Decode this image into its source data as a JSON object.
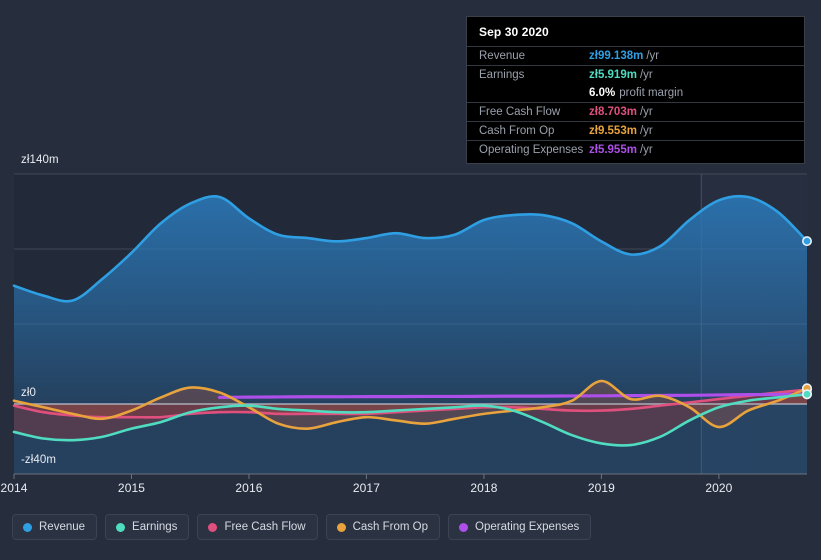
{
  "tooltip": {
    "title": "Sep 30 2020",
    "rows": [
      {
        "key": "Revenue",
        "value": "zł99.138m",
        "unit": "/yr",
        "color": "#2f9fe3"
      },
      {
        "key": "Earnings",
        "value": "zł5.919m",
        "unit": "/yr",
        "color": "#4fdcc0"
      },
      {
        "key": "",
        "value": "6.0%",
        "unit": "",
        "sub": "profit margin",
        "color": "#ffffff"
      },
      {
        "key": "Free Cash Flow",
        "value": "zł8.703m",
        "unit": "/yr",
        "color": "#e0507e"
      },
      {
        "key": "Cash From Op",
        "value": "zł9.553m",
        "unit": "/yr",
        "color": "#e8a33d"
      },
      {
        "key": "Operating Expenses",
        "value": "zł5.955m",
        "unit": "/yr",
        "color": "#ad4fe8"
      }
    ]
  },
  "legend": {
    "items": [
      {
        "label": "Revenue",
        "color": "#2f9fe3"
      },
      {
        "label": "Earnings",
        "color": "#4fdcc0"
      },
      {
        "label": "Free Cash Flow",
        "color": "#e0507e"
      },
      {
        "label": "Cash From Op",
        "color": "#e8a33d"
      },
      {
        "label": "Operating Expenses",
        "color": "#ad4fe8"
      }
    ]
  },
  "chart_data": {
    "type": "area",
    "title": "",
    "xlabel": "",
    "ylabel": "",
    "currency_symbol": "zł",
    "units": "m",
    "ylim": [
      -40,
      140
    ],
    "yticks": [
      140,
      0,
      -40
    ],
    "ytick_labels": [
      "zł140m",
      "zł0",
      "-zł40m"
    ],
    "grid": true,
    "legend_position": "bottom-left",
    "x": [
      2014.0,
      2014.25,
      2014.5,
      2014.75,
      2015.0,
      2015.25,
      2015.5,
      2015.75,
      2016.0,
      2016.25,
      2016.5,
      2016.75,
      2017.0,
      2017.25,
      2017.5,
      2017.75,
      2018.0,
      2018.25,
      2018.5,
      2018.75,
      2019.0,
      2019.25,
      2019.5,
      2019.75,
      2020.0,
      2020.25,
      2020.5,
      2020.75
    ],
    "xticks": [
      2014,
      2015,
      2016,
      2017,
      2018,
      2019,
      2020
    ],
    "xtick_labels": [
      "2014",
      "2015",
      "2016",
      "2017",
      "2018",
      "2019",
      "2020"
    ],
    "forecast_start": 2019.85,
    "series": [
      {
        "name": "Revenue",
        "color": "#2f9fe3",
        "filled": true,
        "values": [
          72,
          66,
          63,
          76,
          92,
          110,
          122,
          126,
          113,
          103,
          101,
          99,
          101,
          104,
          101,
          103,
          112,
          115,
          115,
          110,
          99,
          91,
          96,
          112,
          124,
          126,
          117,
          99.138
        ]
      },
      {
        "name": "Earnings",
        "color": "#4fdcc0",
        "filled": true,
        "values": [
          -17,
          -21,
          -22,
          -20,
          -15,
          -11,
          -5,
          -2,
          -1,
          -3,
          -4,
          -5,
          -5,
          -4,
          -3,
          -2,
          -1,
          -4,
          -11,
          -19,
          -24,
          -25,
          -20,
          -10,
          -2,
          2,
          4,
          5.919
        ]
      },
      {
        "name": "Free Cash Flow",
        "color": "#e0507e",
        "filled": true,
        "values": [
          -1,
          -5,
          -7,
          -8,
          -8,
          -8,
          -6,
          -5,
          -5,
          -6,
          -6,
          -6,
          -6,
          -5,
          -4,
          -3,
          -2,
          -2,
          -3,
          -4,
          -4,
          -3,
          -1,
          1,
          3,
          5,
          7,
          8.703
        ]
      },
      {
        "name": "Cash From Op",
        "color": "#e8a33d",
        "filled": false,
        "values": [
          2,
          -2,
          -6,
          -9,
          -4,
          4,
          10,
          7,
          -2,
          -12,
          -15,
          -11,
          -8,
          -10,
          -12,
          -9,
          -6,
          -4,
          -2,
          2,
          14,
          3,
          5,
          -2,
          -14,
          -4,
          2,
          9.553
        ]
      },
      {
        "name": "Operating Expenses",
        "color": "#ad4fe8",
        "filled": false,
        "start_index": 7,
        "values": [
          null,
          null,
          null,
          null,
          null,
          null,
          null,
          4.0,
          4.2,
          4.3,
          4.4,
          4.4,
          4.5,
          4.5,
          4.6,
          4.6,
          4.7,
          4.8,
          4.8,
          4.9,
          5.0,
          5.1,
          5.2,
          5.3,
          5.5,
          5.7,
          5.8,
          5.955
        ]
      }
    ]
  }
}
